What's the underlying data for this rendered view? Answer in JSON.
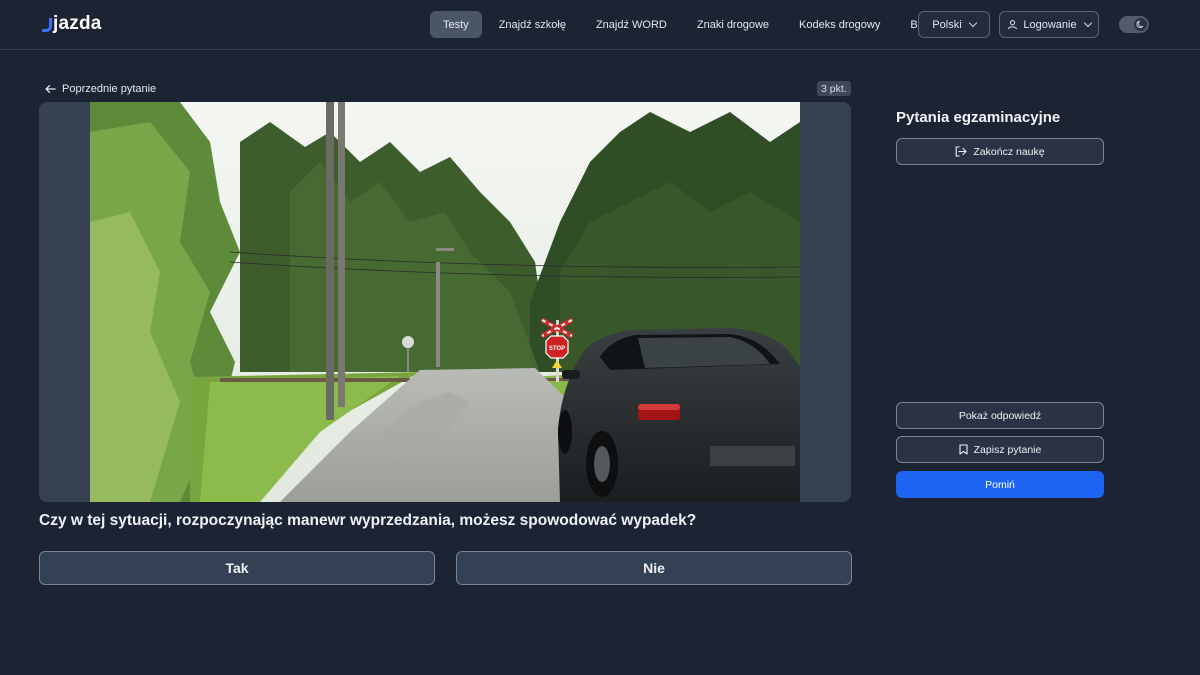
{
  "brand": {
    "name": "jazda"
  },
  "nav": {
    "items": [
      {
        "label": "Testy",
        "active": true
      },
      {
        "label": "Znajdź szkołę",
        "active": false
      },
      {
        "label": "Znajdź WORD",
        "active": false
      },
      {
        "label": "Znaki drogowe",
        "active": false
      },
      {
        "label": "Kodeks drogowy",
        "active": false
      },
      {
        "label": "Blog",
        "active": false
      }
    ],
    "language_label": "Polski",
    "login_label": "Logowanie",
    "theme_toggle_icon": "moon-icon"
  },
  "question": {
    "back_label": "Poprzednie pytanie",
    "points": "3 pkt.",
    "text": "Czy w tej sytuacji, rozpoczynając manewr wyprzedzania, możesz spowodować wypadek?",
    "answers": [
      "Tak",
      "Nie"
    ],
    "sign_text": "STOP"
  },
  "sidebar": {
    "title": "Pytania egzaminacyjne",
    "finish_label": "Zakończ naukę",
    "show_answer_label": "Pokaż odpowiedź",
    "save_label": "Zapisz pytanie",
    "skip_label": "Pomiń"
  },
  "colors": {
    "background": "#1c2434",
    "accent": "#1d64f2",
    "brand_mark": "#3b6df6"
  }
}
